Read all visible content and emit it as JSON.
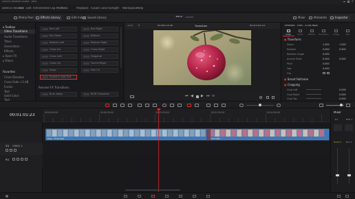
{
  "app": {
    "title": "DaVinci Resolve Studio - Vera",
    "project": "Vera",
    "project_status": "Edited"
  },
  "menu": [
    "DaVinci Resolve",
    "File",
    "Edit",
    "Trim",
    "Timeline",
    "Clip",
    "Mark",
    "View",
    "Playback",
    "Fusion",
    "Color",
    "Fairlight",
    "Workspace",
    "Help"
  ],
  "toolbar": {
    "left": [
      "Media Pool",
      "Effects Library",
      "Edit Index",
      "Sound Library"
    ],
    "right": [
      "Mixer",
      "Metadata",
      "Inspector"
    ]
  },
  "effects_tree": {
    "toolbox": "Toolbox",
    "items": [
      "Video Transitions",
      "Audio Transitions",
      "Titles",
      "Generators",
      "Effects",
      "Open FX",
      "Filters"
    ],
    "favorites_header": "Favorites",
    "favorites": [
      "Cross Dissolve",
      "Cross Fade +3 dB",
      "Fusion",
      "Text",
      "Solid Color",
      "Text"
    ]
  },
  "effects_grid": {
    "tiles": [
      "Bar Left",
      "Bar Right",
      "Bar Down",
      "Bottom",
      "Bottom Left",
      "Bottom Right",
      "Cross Iris",
      "Cross Right",
      "Cross Left",
      "Diagonal",
      "Cross Up",
      "Tunnel Right",
      "Swap",
      "Swirl In",
      "Suave in and Out"
    ],
    "section": "Resolve FX Transitions",
    "section_tiles": [
      "Burn Away",
      "BCIR Transition"
    ]
  },
  "viewer": {
    "zoom": "22%",
    "source_tc": "00:00:23:16",
    "title": "Transition",
    "timecode": "00:01:01:23"
  },
  "inspector": {
    "header": "Timeline - Fruit - 4706.mp4",
    "tabs": [
      "Video",
      "Audio",
      "Effects",
      "Transition",
      "Image",
      "File"
    ],
    "transform": "Transform",
    "rows": [
      {
        "label": "Zoom",
        "x": "1.000",
        "y": "1.000"
      },
      {
        "label": "Position",
        "x": "0.000",
        "y": "0.000"
      },
      {
        "label": "Rotation Angle",
        "x": "0.000",
        "y": ""
      },
      {
        "label": "Anchor Point",
        "x": "0.000",
        "y": "0.000"
      },
      {
        "label": "Pitch",
        "x": "0.000",
        "y": ""
      },
      {
        "label": "Yaw",
        "x": "0.000",
        "y": ""
      },
      {
        "label": "Flip",
        "x": "",
        "y": ""
      }
    ],
    "smart_reframe": "Smart Reframe",
    "cropping": "Cropping",
    "crop_rows": [
      {
        "label": "Crop Left",
        "x": "0.000"
      },
      {
        "label": "Crop Right",
        "x": "0.000"
      },
      {
        "label": "Crop Top",
        "x": "0.000"
      }
    ]
  },
  "timeline": {
    "timecode": "00:01:01:23",
    "ruler": [
      "00:00:00:00",
      "00:00:30:00",
      "00:01:00:00",
      "00:01:30:00",
      "00:02:00:00"
    ],
    "tracks": [
      {
        "id": "V1",
        "name": "Video 1"
      },
      {
        "id": "A1",
        "name": ""
      }
    ],
    "clips": [
      {
        "name": "Gray - Fruit.mp4",
        "start_s": 1.0,
        "end_s": 89.0
      },
      {
        "name": "Fruit.mp4",
        "start_s": 89.0,
        "end_s": 154.0
      }
    ],
    "playhead_s": 62.0
  },
  "mixer": {
    "title": "Mixer",
    "channels": [
      "A1",
      "Bus 1"
    ],
    "labels": [
      "Audio 1",
      "Bus 1"
    ]
  },
  "colors": {
    "accent_red": "#e02a2a",
    "clip_blue": "#3b78b8",
    "bg": "#1b1b1d"
  }
}
